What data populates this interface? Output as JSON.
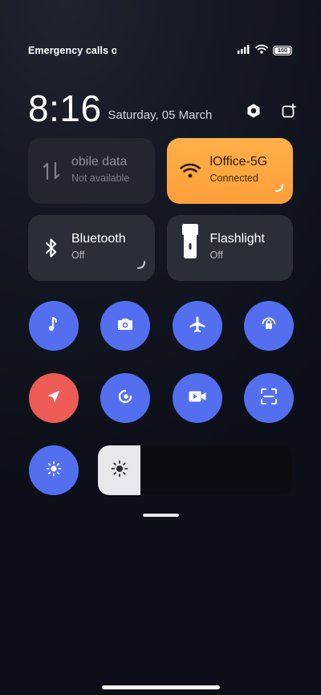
{
  "status_bar": {
    "left_text": "Emergency calls o",
    "battery": "100",
    "icons": [
      "signal-icon",
      "wifi-icon",
      "battery-icon"
    ]
  },
  "header": {
    "time": "8:16",
    "date": "Saturday, 05 March",
    "actions": [
      "settings-hex-icon",
      "edit-icon"
    ]
  },
  "tiles": [
    {
      "title": "obile data",
      "subtitle": "Not available",
      "icon": "mobile-data-icon",
      "state": "disabled"
    },
    {
      "title": "lOffice-5G",
      "subtitle": "Connected",
      "icon": "wifi-icon",
      "state": "on"
    },
    {
      "title": "Bluetooth",
      "subtitle": "Off",
      "icon": "bluetooth-icon",
      "state": "off"
    },
    {
      "title": "Flashlight",
      "subtitle": "Off",
      "icon": "flashlight-icon",
      "state": "off"
    }
  ],
  "quick_toggles": [
    "music-note-icon",
    "camera-icon",
    "airplane-icon",
    "lock-rotation-icon",
    "location-icon",
    "do-not-disturb-icon",
    "video-camera-icon",
    "scan-icon"
  ],
  "brightness": {
    "toggle_icon": "brightness-icon",
    "level": 0.22
  },
  "colors": {
    "accent_blue": "#536ff0",
    "accent_red": "#ee5b57",
    "accent_orange": "#ffa640",
    "tile_dark": "#2a2e37"
  }
}
